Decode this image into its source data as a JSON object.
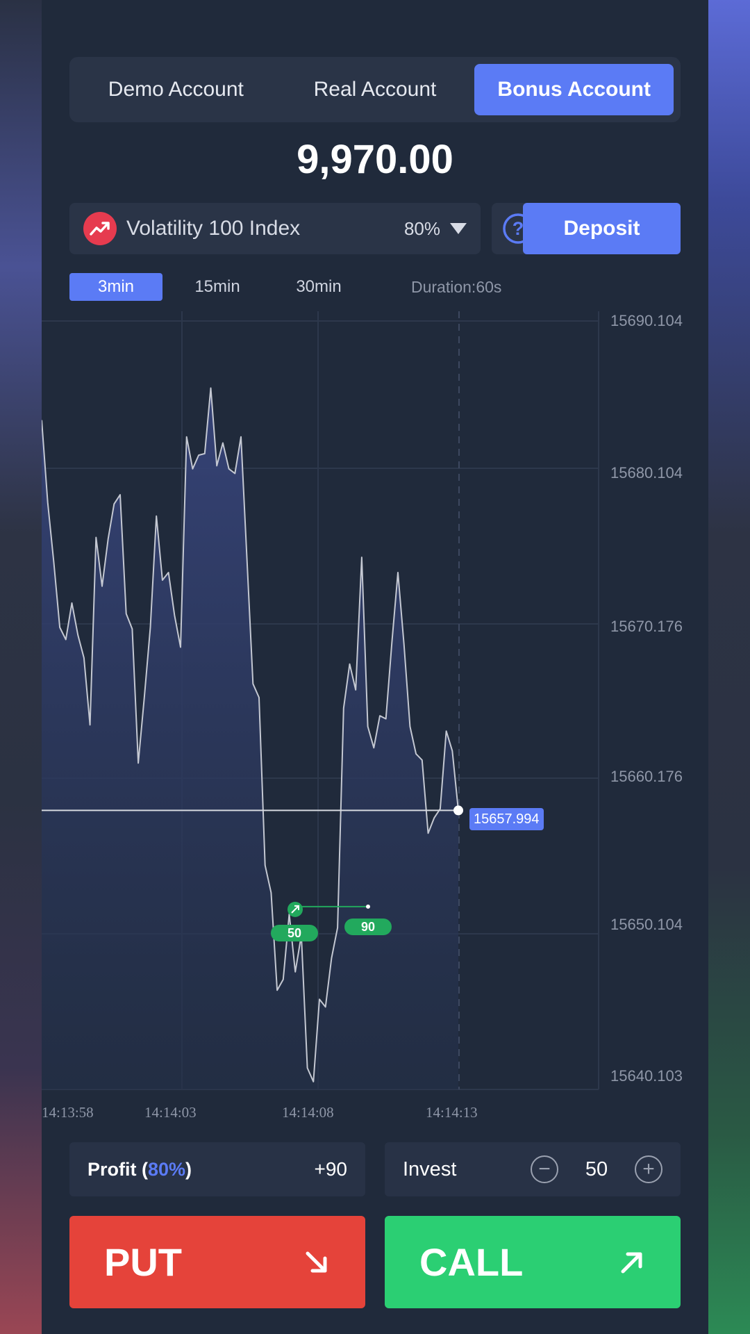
{
  "accounts": {
    "tabs": [
      "Demo Account",
      "Real Account",
      "Bonus Account"
    ],
    "active": "Bonus Account"
  },
  "balance": "9,970.00",
  "asset": {
    "icon": "trend-up-icon",
    "name": "Volatility 100 Index",
    "payout": "80%"
  },
  "deposit_label": "Deposit",
  "timeframes": [
    "3min",
    "15min",
    "30min"
  ],
  "active_timeframe": "3min",
  "duration": "Duration:60s",
  "current_price": "15657.994",
  "trade": {
    "invest_badge": "50",
    "profit_badge": "90"
  },
  "colors": {
    "accent": "#5b7bf5",
    "put": "#e5433a",
    "call": "#2bcf73",
    "trade": "#22a95d",
    "background": "#202a3b"
  },
  "chart_data": {
    "type": "area",
    "y_tick_labels": [
      "15690.104",
      "15680.104",
      "15670.176",
      "15660.176",
      "15650.104",
      "15640.103"
    ],
    "x_tick_labels": [
      "14:13:58",
      "14:14:03",
      "14:14:08",
      "14:14:13"
    ],
    "ylim": [
      15640.1,
      15690.1
    ],
    "series": [
      {
        "values": [
          15683.6,
          15678.2,
          15674.3,
          15670.0,
          15669.2,
          15671.6,
          15669.5,
          15668.0,
          15663.6,
          15675.9,
          15672.7,
          15675.8,
          15678.1,
          15678.7,
          15670.9,
          15669.9,
          15661.1,
          15665.4,
          15670.0,
          15677.3,
          15673.1,
          15673.6,
          15670.8,
          15668.7,
          15682.5,
          15680.4,
          15681.3,
          15681.4,
          15685.7,
          15680.6,
          15682.1,
          15680.4,
          15680.1,
          15682.5,
          15674.4,
          15666.3,
          15665.4,
          15654.4,
          15652.6,
          15646.2,
          15646.9,
          15651.2,
          15647.4,
          15649.8,
          15641.1,
          15640.2,
          15645.6,
          15645.1,
          15648.3,
          15650.3,
          15664.7,
          15667.6,
          15665.9,
          15674.6,
          15663.5,
          15662.1,
          15664.2,
          15664.0,
          15669.0,
          15673.6,
          15668.9,
          15663.5,
          15661.7,
          15661.3,
          15656.5,
          15657.5,
          15658.1,
          15663.2,
          15661.9,
          15658.0
        ],
        "unit": "price"
      }
    ],
    "current_value": 15657.994,
    "trade_entry": 15651.5,
    "grid": true
  },
  "profit": {
    "label": "Profit",
    "pct": "80%",
    "value": "+90"
  },
  "invest": {
    "label": "Invest",
    "value": "50",
    "minus_icon": "minus-circle-icon",
    "plus_icon": "plus-circle-icon"
  },
  "put_label": "PUT",
  "call_label": "CALL"
}
